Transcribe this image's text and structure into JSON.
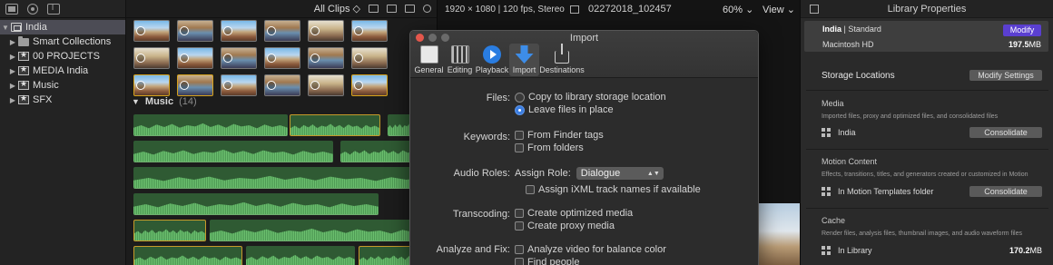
{
  "sidebar": {
    "items": [
      {
        "label": "India",
        "disclosure": "▼",
        "icon": "library-icon",
        "selected": true
      },
      {
        "label": "Smart Collections",
        "disclosure": "▶",
        "icon": "folder-icon"
      },
      {
        "label": "00 PROJECTS",
        "disclosure": "▶",
        "icon": "event-icon"
      },
      {
        "label": "MEDIA India",
        "disclosure": "▶",
        "icon": "event-icon"
      },
      {
        "label": "Music",
        "disclosure": "▶",
        "icon": "event-icon"
      },
      {
        "label": "SFX",
        "disclosure": "▶",
        "icon": "event-icon"
      }
    ]
  },
  "browser": {
    "filter_label": "All Clips ◇",
    "music_group": {
      "disclosure": "▼",
      "label": "Music",
      "count": "(14)"
    }
  },
  "viewer": {
    "format": "1920 × 1080 | 120 fps, Stereo",
    "clip_name": "02272018_102457",
    "zoom": "60% ⌄",
    "view": "View ⌄"
  },
  "dialog": {
    "title": "Import",
    "tabs": [
      {
        "label": "General",
        "icon": "general-icon"
      },
      {
        "label": "Editing",
        "icon": "editing-icon"
      },
      {
        "label": "Playback",
        "icon": "playback-icon"
      },
      {
        "label": "Import",
        "icon": "import-icon",
        "active": true
      },
      {
        "label": "Destinations",
        "icon": "destinations-icon"
      }
    ],
    "files": {
      "label": "Files:",
      "copy": "Copy to library storage location",
      "leave": "Leave files in place",
      "selected": "leave"
    },
    "keywords": {
      "label": "Keywords:",
      "finder_tags": "From Finder tags",
      "folders": "From folders"
    },
    "audio_roles": {
      "label": "Audio Roles:",
      "assign_role_label": "Assign Role:",
      "assign_role_value": "Dialogue",
      "ixml": "Assign iXML track names if available"
    },
    "transcoding": {
      "label": "Transcoding:",
      "optimized": "Create optimized media",
      "proxy": "Create proxy media"
    },
    "analyze": {
      "label": "Analyze and Fix:",
      "balance": "Analyze video for balance color",
      "people": "Find people"
    }
  },
  "inspector": {
    "title": "Library Properties",
    "library_name": "India",
    "library_kind": " | Standard",
    "modify_label": "Modify",
    "volume": "Macintosh HD",
    "volume_size": "197.5",
    "volume_unit": "MB",
    "storage_title": "Storage Locations",
    "modify_settings_label": "Modify Settings",
    "media": {
      "heading": "Media",
      "desc": "Imported files, proxy and optimized files, and consolidated files",
      "location": "India",
      "button": "Consolidate"
    },
    "motion": {
      "heading": "Motion Content",
      "desc": "Effects, transitions, titles, and generators created or customized in Motion",
      "location": "In Motion Templates folder",
      "button": "Consolidate"
    },
    "cache": {
      "heading": "Cache",
      "desc": "Render files, analysis files, thumbnail images, and audio waveform files",
      "location": "In Library",
      "size": "170.2",
      "unit": "MB"
    }
  }
}
